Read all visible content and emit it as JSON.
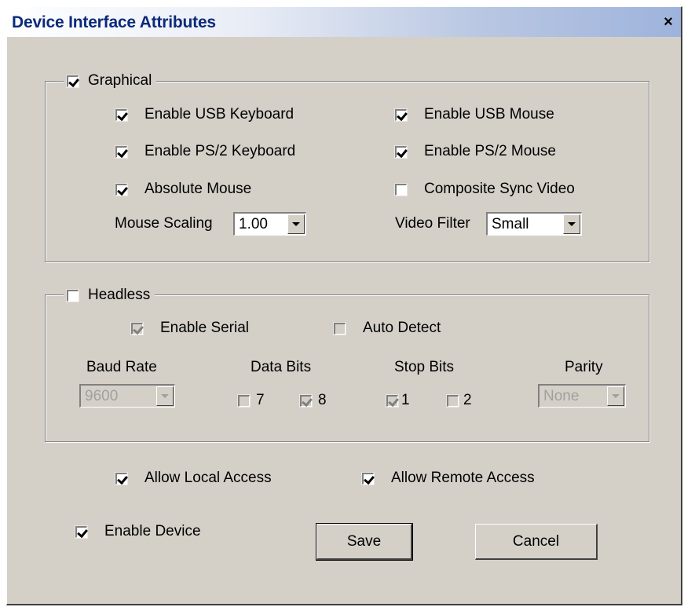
{
  "window": {
    "title": "Device Interface Attributes",
    "close_glyph": "×"
  },
  "graphical": {
    "label": "Graphical",
    "checked": true,
    "enable_usb_keyboard": {
      "label": "Enable USB Keyboard",
      "checked": true
    },
    "enable_usb_mouse": {
      "label": "Enable USB Mouse",
      "checked": true
    },
    "enable_ps2_keyboard": {
      "label": "Enable PS/2 Keyboard",
      "checked": true
    },
    "enable_ps2_mouse": {
      "label": "Enable PS/2 Mouse",
      "checked": true
    },
    "absolute_mouse": {
      "label": "Absolute Mouse",
      "checked": true
    },
    "composite_sync_video": {
      "label": "Composite Sync Video",
      "checked": false
    },
    "mouse_scaling": {
      "label": "Mouse Scaling",
      "value": "1.00"
    },
    "video_filter": {
      "label": "Video Filter",
      "value": "Small"
    }
  },
  "headless": {
    "label": "Headless",
    "checked": false,
    "enable_serial": {
      "label": "Enable Serial",
      "checked": true,
      "disabled": true
    },
    "auto_detect": {
      "label": "Auto Detect",
      "checked": false
    },
    "baud_rate": {
      "label": "Baud Rate",
      "value": "9600"
    },
    "data_bits": {
      "label": "Data Bits",
      "opt7": "7",
      "opt7_checked": false,
      "opt8": "8",
      "opt8_checked": true
    },
    "stop_bits": {
      "label": "Stop Bits",
      "opt1": "1",
      "opt1_checked": true,
      "opt2": "2",
      "opt2_checked": false
    },
    "parity": {
      "label": "Parity",
      "value": "None"
    }
  },
  "access": {
    "allow_local": {
      "label": "Allow Local Access",
      "checked": true
    },
    "allow_remote": {
      "label": "Allow Remote Access",
      "checked": true
    }
  },
  "enable_device": {
    "label": "Enable Device",
    "checked": true
  },
  "buttons": {
    "save": "Save",
    "cancel": "Cancel"
  }
}
